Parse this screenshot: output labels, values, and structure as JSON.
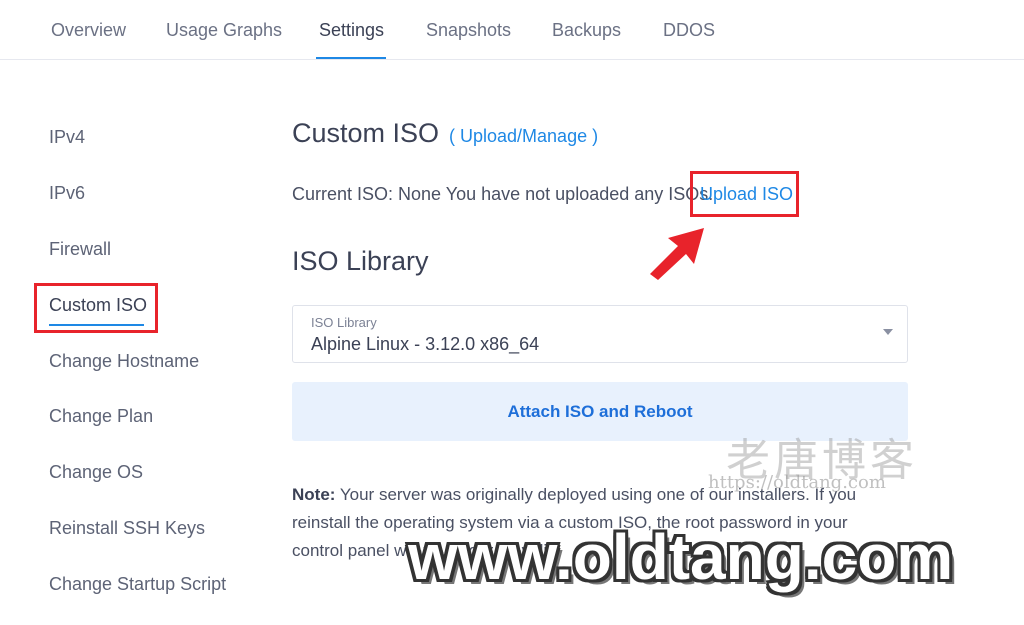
{
  "tabs": [
    "Overview",
    "Usage Graphs",
    "Settings",
    "Snapshots",
    "Backups",
    "DDOS"
  ],
  "active_tab": "Settings",
  "sidebar": {
    "items": [
      "IPv4",
      "IPv6",
      "Firewall",
      "Custom ISO",
      "Change Hostname",
      "Change Plan",
      "Change OS",
      "Reinstall SSH Keys",
      "Change Startup Script"
    ],
    "active": "Custom ISO"
  },
  "custom_iso": {
    "title": "Custom ISO",
    "manage_link": "( Upload/Manage )",
    "current_text": "Current ISO: None You have not uploaded any ISOs.",
    "upload_link": "Upload ISO"
  },
  "iso_library": {
    "title": "ISO Library",
    "select_label": "ISO Library",
    "selected_value": "Alpine Linux - 3.12.0 x86_64",
    "attach_button": "Attach ISO and Reboot"
  },
  "note": {
    "label": "Note:",
    "text": " Your server was originally deployed using one of our installers. If you reinstall the operating system via a custom ISO, the root password in your control panel will no longer be valid."
  },
  "watermark": {
    "cn": "老唐博客",
    "small": "https://oldtang.com",
    "big": "www.oldtang.com"
  },
  "colors": {
    "accent": "#1e88e5",
    "highlight": "#e8232b"
  }
}
